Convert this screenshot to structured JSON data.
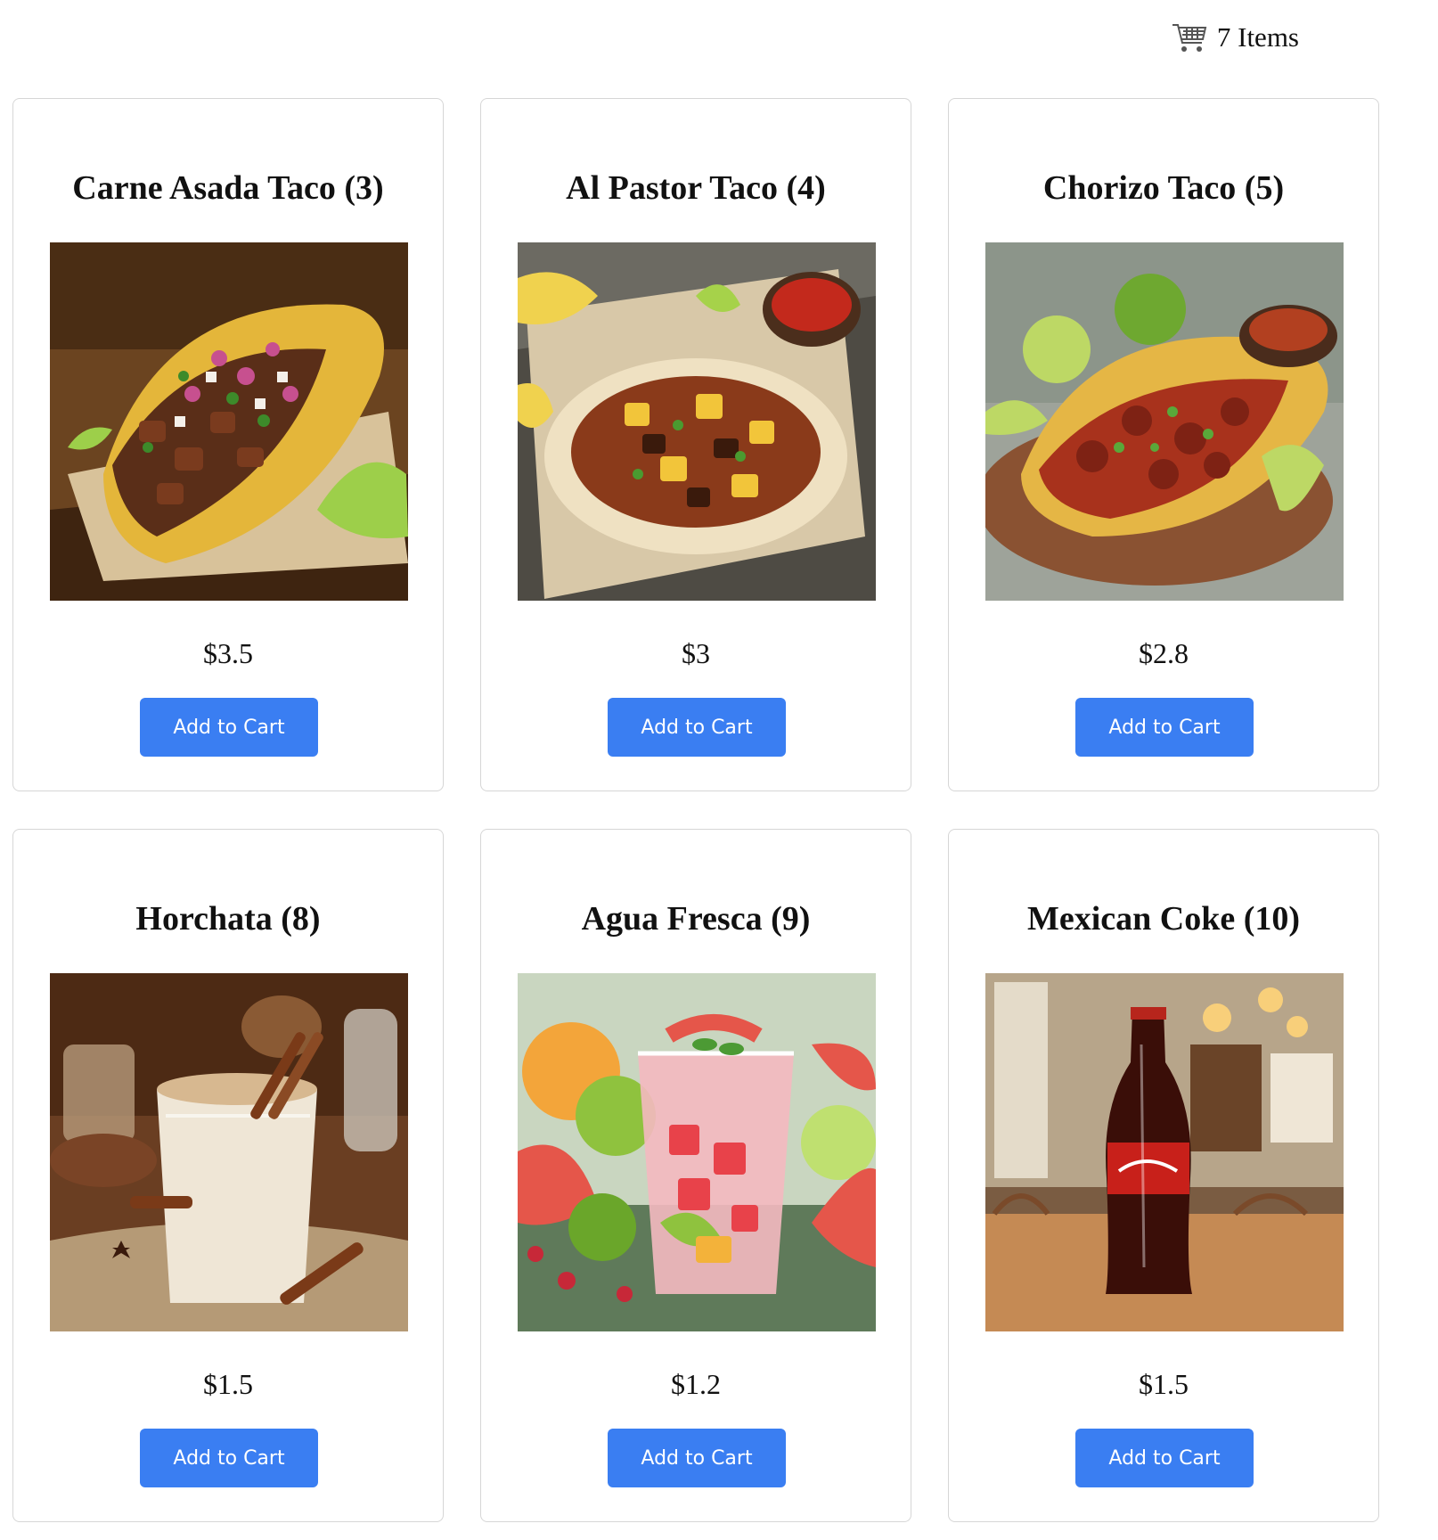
{
  "cart": {
    "icon": "shopping-cart-icon",
    "label": "7 Items"
  },
  "products": [
    {
      "title": "Carne Asada Taco (3)",
      "price": "$3.5",
      "button": "Add to Cart",
      "image": "carne-asada-taco-photo"
    },
    {
      "title": "Al Pastor Taco (4)",
      "price": "$3",
      "button": "Add to Cart",
      "image": "al-pastor-taco-photo"
    },
    {
      "title": "Chorizo Taco (5)",
      "price": "$2.8",
      "button": "Add to Cart",
      "image": "chorizo-taco-photo"
    },
    {
      "title": "Horchata (8)",
      "price": "$1.5",
      "button": "Add to Cart",
      "image": "horchata-photo"
    },
    {
      "title": "Agua Fresca (9)",
      "price": "$1.2",
      "button": "Add to Cart",
      "image": "agua-fresca-photo"
    },
    {
      "title": "Mexican Coke (10)",
      "price": "$1.5",
      "button": "Add to Cart",
      "image": "mexican-coke-photo"
    }
  ],
  "colors": {
    "button_bg": "#3a7ef2",
    "button_text": "#ffffff",
    "card_border": "#d6d6d6"
  }
}
